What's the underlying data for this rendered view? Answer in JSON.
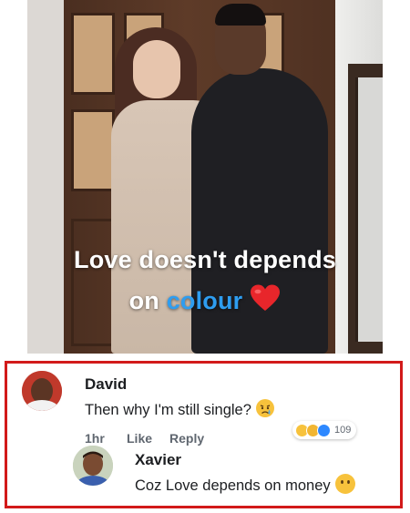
{
  "photo": {
    "caption_line1": "Love doesn't depends",
    "caption_line2_prefix": "on ",
    "caption_line2_highlight": "colour",
    "highlight_color": "#2e9df0",
    "heart_icon": "red-heart-emoji"
  },
  "comments": {
    "border_color": "#d21a1a",
    "main": {
      "author": "David",
      "text": "Then why I'm still single?",
      "emoji": "crying-face-emoji",
      "time": "1hr",
      "like_label": "Like",
      "reply_label": "Reply",
      "reactions": [
        "haha",
        "sad",
        "like"
      ],
      "reaction_count": "109"
    },
    "reply": {
      "author": "Xavier",
      "text": "Coz Love depends on money",
      "emoji": "no-mouth-face-emoji"
    }
  }
}
